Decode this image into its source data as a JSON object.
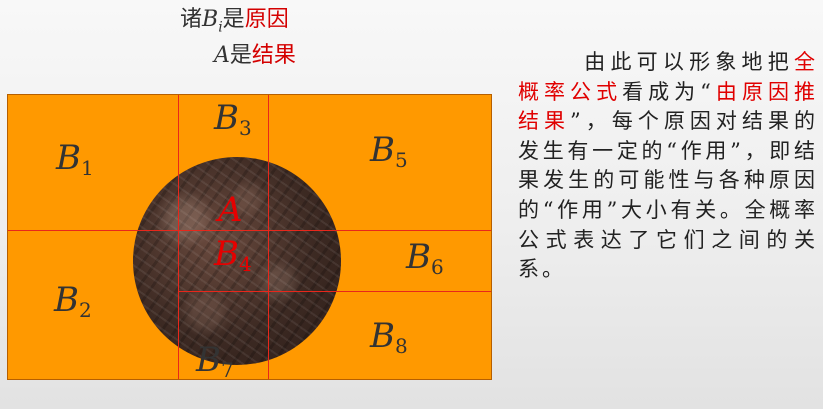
{
  "caption": {
    "line1_prefix": "诸",
    "line1_var": "B",
    "line1_sub": "i",
    "line1_mid": "是",
    "line1_red": "原因",
    "line2_var": "A",
    "line2_mid": "是",
    "line2_red": "结果"
  },
  "figure": {
    "colors": {
      "rectangle": "#ff9900",
      "lines": "#e8271b",
      "labels": "#333333",
      "highlight": "#e60000"
    },
    "labels": {
      "b1": {
        "letter": "B",
        "sub": "1"
      },
      "b2": {
        "letter": "B",
        "sub": "2"
      },
      "b3": {
        "letter": "B",
        "sub": "3"
      },
      "b4": {
        "letter": "B",
        "sub": "4"
      },
      "b5": {
        "letter": "B",
        "sub": "5"
      },
      "b6": {
        "letter": "B",
        "sub": "6"
      },
      "b7": {
        "letter": "B",
        "sub": "7"
      },
      "b8": {
        "letter": "B",
        "sub": "8"
      },
      "a": {
        "letter": "A"
      }
    }
  },
  "paragraph": {
    "t1": "由此可以形象地把",
    "red1": "全概率公式",
    "t2": "看成为“",
    "red2": "由原因推结果",
    "t3": "”，每个原因对结果的发生有一定的“作用”，即结果发生的可能性与各种原因的“作用”大小有关。全概率公式表达了它们之间的关系。"
  }
}
